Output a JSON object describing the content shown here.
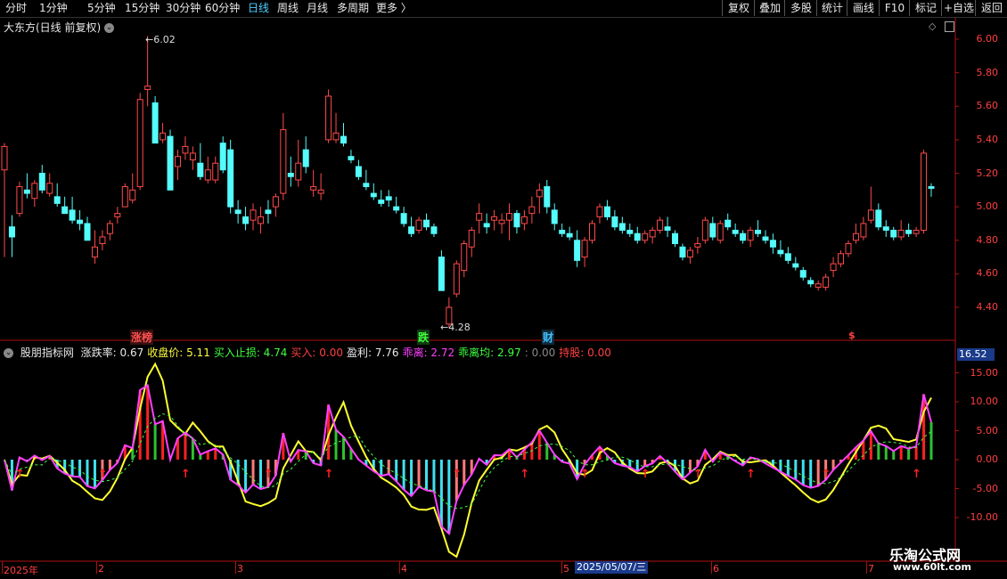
{
  "toolbar": {
    "periods": [
      {
        "label": "分时",
        "active": false
      },
      {
        "label": "1分钟",
        "active": false
      },
      {
        "label": "5分钟",
        "active": false
      },
      {
        "label": "15分钟",
        "active": false
      },
      {
        "label": "30分钟",
        "active": false
      },
      {
        "label": "60分钟",
        "active": false
      },
      {
        "label": "日线",
        "active": true
      },
      {
        "label": "周线",
        "active": false
      },
      {
        "label": "月线",
        "active": false
      },
      {
        "label": "多周期",
        "active": false
      },
      {
        "label": "更多",
        "active": false
      }
    ],
    "right_buttons": [
      "复权",
      "叠加",
      "多股",
      "统计",
      "画线",
      "F10",
      "标记",
      "+自选",
      "返回"
    ]
  },
  "main_chart": {
    "title": "大东方(日线 前复权)",
    "y_ticks": [
      "6.00",
      "5.80",
      "5.60",
      "5.40",
      "5.20",
      "5.00",
      "4.80",
      "4.60",
      "4.40"
    ],
    "high_label": "6.02",
    "low_label": "4.28",
    "markers": [
      {
        "text": "涨榜",
        "color": "#ff5050",
        "bg": "#3a1010"
      },
      {
        "text": "跌",
        "color": "#40ff40",
        "bg": "#103a10"
      },
      {
        "text": "财",
        "color": "#40c0ff",
        "bg": "#102a3a"
      },
      {
        "text": "$",
        "color": "#ff4040",
        "bg": "#000"
      }
    ]
  },
  "indicator": {
    "name": "股朋指标网",
    "fields": [
      {
        "text": "涨跌率: 0.67",
        "color": "#e8e8e8"
      },
      {
        "text": "收盘价: 5.11",
        "color": "#ffff40"
      },
      {
        "text": "买入止损: 4.74",
        "color": "#40ff40"
      },
      {
        "text": "买入: 0.00",
        "color": "#ff4040"
      },
      {
        "text": "盈利: 7.76",
        "color": "#e8e8e8"
      },
      {
        "text": "乖离: 2.72",
        "color": "#ff40ff"
      },
      {
        "text": "乖离均: 2.97",
        "color": "#40ff40"
      },
      {
        "text": ": 0.00",
        "color": "#888888"
      },
      {
        "text": "持股: 0.00",
        "color": "#ff4040"
      }
    ],
    "current_value": "16.52",
    "y_ticks": [
      "15.00",
      "10.00",
      "5.00",
      "0.00",
      "-5.00",
      "-10.00"
    ]
  },
  "date_axis": {
    "labels": [
      "2025年",
      "2",
      "3",
      "4",
      "5",
      "6",
      "7"
    ],
    "cursor_date": "2025/05/07/三"
  },
  "watermark": {
    "title": "乐淘公式网",
    "url": "www.60lt.com"
  },
  "chart_data": {
    "type": "candlestick",
    "title": "大东方(日线 前复权)",
    "ylim": [
      4.28,
      6.05
    ],
    "candles": [
      [
        5.22,
        5.38,
        4.7,
        5.36
      ],
      [
        4.88,
        4.95,
        4.7,
        4.82
      ],
      [
        4.96,
        5.15,
        4.94,
        5.12
      ],
      [
        5.1,
        5.2,
        5.05,
        5.08
      ],
      [
        5.05,
        5.16,
        5.0,
        5.14
      ],
      [
        5.2,
        5.25,
        5.08,
        5.1
      ],
      [
        5.08,
        5.2,
        5.06,
        5.14
      ],
      [
        5.06,
        5.14,
        5.0,
        5.02
      ],
      [
        5.0,
        5.06,
        4.96,
        4.96
      ],
      [
        4.98,
        5.06,
        4.9,
        4.92
      ],
      [
        4.92,
        4.98,
        4.86,
        4.9
      ],
      [
        4.9,
        4.94,
        4.8,
        4.8
      ],
      [
        4.7,
        4.86,
        4.66,
        4.76
      ],
      [
        4.78,
        4.86,
        4.74,
        4.82
      ],
      [
        4.84,
        4.92,
        4.8,
        4.9
      ],
      [
        4.94,
        5.0,
        4.9,
        4.96
      ],
      [
        5.0,
        5.14,
        5.0,
        5.12
      ],
      [
        5.04,
        5.2,
        5.02,
        5.1
      ],
      [
        5.12,
        5.68,
        5.1,
        5.64
      ],
      [
        5.7,
        6.02,
        5.6,
        5.72
      ],
      [
        5.62,
        5.66,
        5.4,
        5.38
      ],
      [
        5.4,
        5.5,
        5.38,
        5.44
      ],
      [
        5.42,
        5.46,
        5.1,
        5.1
      ],
      [
        5.24,
        5.34,
        5.16,
        5.3
      ],
      [
        5.32,
        5.42,
        5.28,
        5.36
      ],
      [
        5.28,
        5.36,
        5.22,
        5.32
      ],
      [
        5.26,
        5.38,
        5.16,
        5.18
      ],
      [
        5.16,
        5.3,
        5.14,
        5.22
      ],
      [
        5.16,
        5.3,
        5.14,
        5.26
      ],
      [
        5.38,
        5.42,
        5.2,
        5.22
      ],
      [
        5.34,
        5.4,
        4.96,
        5.0
      ],
      [
        4.98,
        5.04,
        4.9,
        4.96
      ],
      [
        4.94,
        5.0,
        4.86,
        4.9
      ],
      [
        4.92,
        5.02,
        4.86,
        4.98
      ],
      [
        4.9,
        5.0,
        4.84,
        4.94
      ],
      [
        4.98,
        5.04,
        4.9,
        4.96
      ],
      [
        5.0,
        5.08,
        4.94,
        5.06
      ],
      [
        5.08,
        5.56,
        5.04,
        5.46
      ],
      [
        5.2,
        5.3,
        5.12,
        5.18
      ],
      [
        5.16,
        5.4,
        5.12,
        5.26
      ],
      [
        5.34,
        5.42,
        5.2,
        5.24
      ],
      [
        5.1,
        5.22,
        5.06,
        5.12
      ],
      [
        5.08,
        5.2,
        5.04,
        5.1
      ],
      [
        5.4,
        5.7,
        5.38,
        5.66
      ],
      [
        5.4,
        5.56,
        5.38,
        5.44
      ],
      [
        5.42,
        5.5,
        5.36,
        5.38
      ],
      [
        5.3,
        5.34,
        5.26,
        5.28
      ],
      [
        5.24,
        5.28,
        5.16,
        5.18
      ],
      [
        5.14,
        5.22,
        5.1,
        5.12
      ],
      [
        5.08,
        5.14,
        5.04,
        5.06
      ],
      [
        5.04,
        5.1,
        5.0,
        5.02
      ],
      [
        5.06,
        5.1,
        5.0,
        5.04
      ],
      [
        5.0,
        5.06,
        4.96,
        4.98
      ],
      [
        4.96,
        5.0,
        4.88,
        4.9
      ],
      [
        4.88,
        4.94,
        4.82,
        4.84
      ],
      [
        4.86,
        4.94,
        4.84,
        4.92
      ],
      [
        4.92,
        4.96,
        4.86,
        4.88
      ],
      [
        4.88,
        4.9,
        4.82,
        4.84
      ],
      [
        4.7,
        4.74,
        4.5,
        4.5
      ],
      [
        4.3,
        4.46,
        4.28,
        4.4
      ],
      [
        4.48,
        4.68,
        4.46,
        4.66
      ],
      [
        4.62,
        4.8,
        4.58,
        4.78
      ],
      [
        4.76,
        4.88,
        4.7,
        4.86
      ],
      [
        4.92,
        5.02,
        4.84,
        4.96
      ],
      [
        4.9,
        4.96,
        4.84,
        4.88
      ],
      [
        4.92,
        4.98,
        4.86,
        4.94
      ],
      [
        4.9,
        4.96,
        4.84,
        4.92
      ],
      [
        4.92,
        5.02,
        4.8,
        4.96
      ],
      [
        4.96,
        4.98,
        4.84,
        4.88
      ],
      [
        4.9,
        4.98,
        4.86,
        4.94
      ],
      [
        4.96,
        5.06,
        4.9,
        5.0
      ],
      [
        5.06,
        5.14,
        4.96,
        5.1
      ],
      [
        5.12,
        5.16,
        4.96,
        5.0
      ],
      [
        4.98,
        5.02,
        4.86,
        4.9
      ],
      [
        4.86,
        4.9,
        4.82,
        4.84
      ],
      [
        4.84,
        4.88,
        4.8,
        4.82
      ],
      [
        4.8,
        4.86,
        4.64,
        4.68
      ],
      [
        4.7,
        4.82,
        4.64,
        4.8
      ],
      [
        4.8,
        4.92,
        4.78,
        4.9
      ],
      [
        4.94,
        5.02,
        4.9,
        5.0
      ],
      [
        5.0,
        5.04,
        4.92,
        4.94
      ],
      [
        4.94,
        4.98,
        4.86,
        4.88
      ],
      [
        4.9,
        4.94,
        4.84,
        4.86
      ],
      [
        4.86,
        4.9,
        4.82,
        4.84
      ],
      [
        4.84,
        4.88,
        4.78,
        4.8
      ],
      [
        4.8,
        4.86,
        4.78,
        4.84
      ],
      [
        4.82,
        4.88,
        4.78,
        4.86
      ],
      [
        4.86,
        4.94,
        4.84,
        4.92
      ],
      [
        4.88,
        4.94,
        4.82,
        4.86
      ],
      [
        4.84,
        4.86,
        4.76,
        4.78
      ],
      [
        4.76,
        4.78,
        4.68,
        4.7
      ],
      [
        4.7,
        4.76,
        4.66,
        4.74
      ],
      [
        4.76,
        4.82,
        4.72,
        4.78
      ],
      [
        4.8,
        4.94,
        4.78,
        4.92
      ],
      [
        4.9,
        4.94,
        4.8,
        4.82
      ],
      [
        4.8,
        4.92,
        4.78,
        4.9
      ],
      [
        4.92,
        4.96,
        4.86,
        4.88
      ],
      [
        4.86,
        4.9,
        4.82,
        4.84
      ],
      [
        4.84,
        4.86,
        4.78,
        4.8
      ],
      [
        4.8,
        4.88,
        4.76,
        4.86
      ],
      [
        4.86,
        4.92,
        4.82,
        4.84
      ],
      [
        4.82,
        4.86,
        4.78,
        4.8
      ],
      [
        4.8,
        4.84,
        4.72,
        4.76
      ],
      [
        4.74,
        4.8,
        4.7,
        4.72
      ],
      [
        4.72,
        4.76,
        4.66,
        4.68
      ],
      [
        4.66,
        4.7,
        4.62,
        4.64
      ],
      [
        4.62,
        4.64,
        4.56,
        4.58
      ],
      [
        4.56,
        4.58,
        4.52,
        4.54
      ],
      [
        4.52,
        4.56,
        4.5,
        4.54
      ],
      [
        4.52,
        4.6,
        4.5,
        4.58
      ],
      [
        4.62,
        4.7,
        4.58,
        4.66
      ],
      [
        4.66,
        4.74,
        4.64,
        4.72
      ],
      [
        4.72,
        4.8,
        4.7,
        4.78
      ],
      [
        4.8,
        4.9,
        4.78,
        4.84
      ],
      [
        4.82,
        4.94,
        4.8,
        4.9
      ],
      [
        4.92,
        5.12,
        4.9,
        4.98
      ],
      [
        4.98,
        5.02,
        4.86,
        4.88
      ],
      [
        4.88,
        4.92,
        4.82,
        4.86
      ],
      [
        4.86,
        4.88,
        4.8,
        4.82
      ],
      [
        4.82,
        4.92,
        4.8,
        4.86
      ],
      [
        4.86,
        4.9,
        4.82,
        4.84
      ],
      [
        4.84,
        4.88,
        4.82,
        4.86
      ],
      [
        4.86,
        5.34,
        4.84,
        5.32
      ],
      [
        5.12,
        5.14,
        5.06,
        5.11
      ]
    ]
  }
}
